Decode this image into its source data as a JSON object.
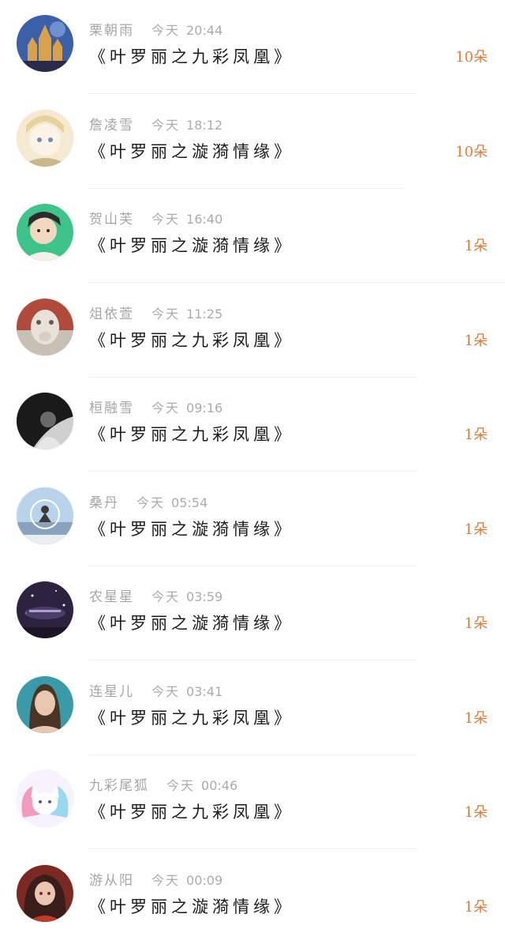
{
  "items": [
    {
      "name": "栗朝雨",
      "day": "今天",
      "time": "20:44",
      "title": "《叶罗丽之九彩凤凰》",
      "count": "10朵",
      "avatar_icon": "castle-avatar",
      "avatar_colors": [
        "#3b5fa8",
        "#d9a24a",
        "#2a2a4a"
      ]
    },
    {
      "name": "詹凌雪",
      "day": "今天",
      "time": "18:12",
      "title": "《叶罗丽之漩漪情缘》",
      "count": "10朵",
      "avatar_icon": "anime-girl-avatar",
      "avatar_colors": [
        "#f4ead2",
        "#e6d29a",
        "#c8b88a"
      ]
    },
    {
      "name": "贺山芙",
      "day": "今天",
      "time": "16:40",
      "title": "《叶罗丽之漩漪情缘》",
      "count": "1朵",
      "avatar_icon": "anime-boy-avatar",
      "avatar_colors": [
        "#3ec48a",
        "#2b2b2b",
        "#f3d8c0"
      ]
    },
    {
      "name": "俎依萱",
      "day": "今天",
      "time": "11:25",
      "title": "《叶罗丽之九彩凤凰》",
      "count": "1朵",
      "avatar_icon": "alpaca-avatar",
      "avatar_colors": [
        "#b04a3a",
        "#e8e2da",
        "#6b5a4a"
      ]
    },
    {
      "name": "桓融雪",
      "day": "今天",
      "time": "09:16",
      "title": "《叶罗丽之九彩凤凰》",
      "count": "1朵",
      "avatar_icon": "dark-photo-avatar",
      "avatar_colors": [
        "#1a1a1a",
        "#cfcfcf",
        "#6a6a6a"
      ]
    },
    {
      "name": "桑丹",
      "day": "今天",
      "time": "05:54",
      "title": "《叶罗丽之漩漪情缘》",
      "count": "1朵",
      "avatar_icon": "swing-avatar",
      "avatar_colors": [
        "#b9d4ea",
        "#e9eef2",
        "#3a3a3a"
      ]
    },
    {
      "name": "农星星",
      "day": "今天",
      "time": "03:59",
      "title": "《叶罗丽之漩漪情缘》",
      "count": "1朵",
      "avatar_icon": "night-sky-avatar",
      "avatar_colors": [
        "#2b2340",
        "#5a4a7a",
        "#c9b8e6"
      ]
    },
    {
      "name": "连星儿",
      "day": "今天",
      "time": "03:41",
      "title": "《叶罗丽之九彩凤凰》",
      "count": "1朵",
      "avatar_icon": "portrait-avatar",
      "avatar_colors": [
        "#3a9aa8",
        "#e8c9b0",
        "#4a3426"
      ]
    },
    {
      "name": "九彩尾狐",
      "day": "今天",
      "time": "00:46",
      "title": "《叶罗丽之九彩凤凰》",
      "count": "1朵",
      "avatar_icon": "fox-avatar",
      "avatar_colors": [
        "#f6f2ff",
        "#f39ac0",
        "#9ad8f0"
      ]
    },
    {
      "name": "游从阳",
      "day": "今天",
      "time": "00:09",
      "title": "《叶罗丽之漩漪情缘》",
      "count": "1朵",
      "avatar_icon": "anime-princess-avatar",
      "avatar_colors": [
        "#7a2a22",
        "#e9c6b0",
        "#3a1e1a"
      ]
    }
  ],
  "colors": {
    "count_accent": "#e07b3a",
    "meta_gray": "#a6a6a6",
    "title_black": "#1c1c1c",
    "divider": "#efefef"
  }
}
